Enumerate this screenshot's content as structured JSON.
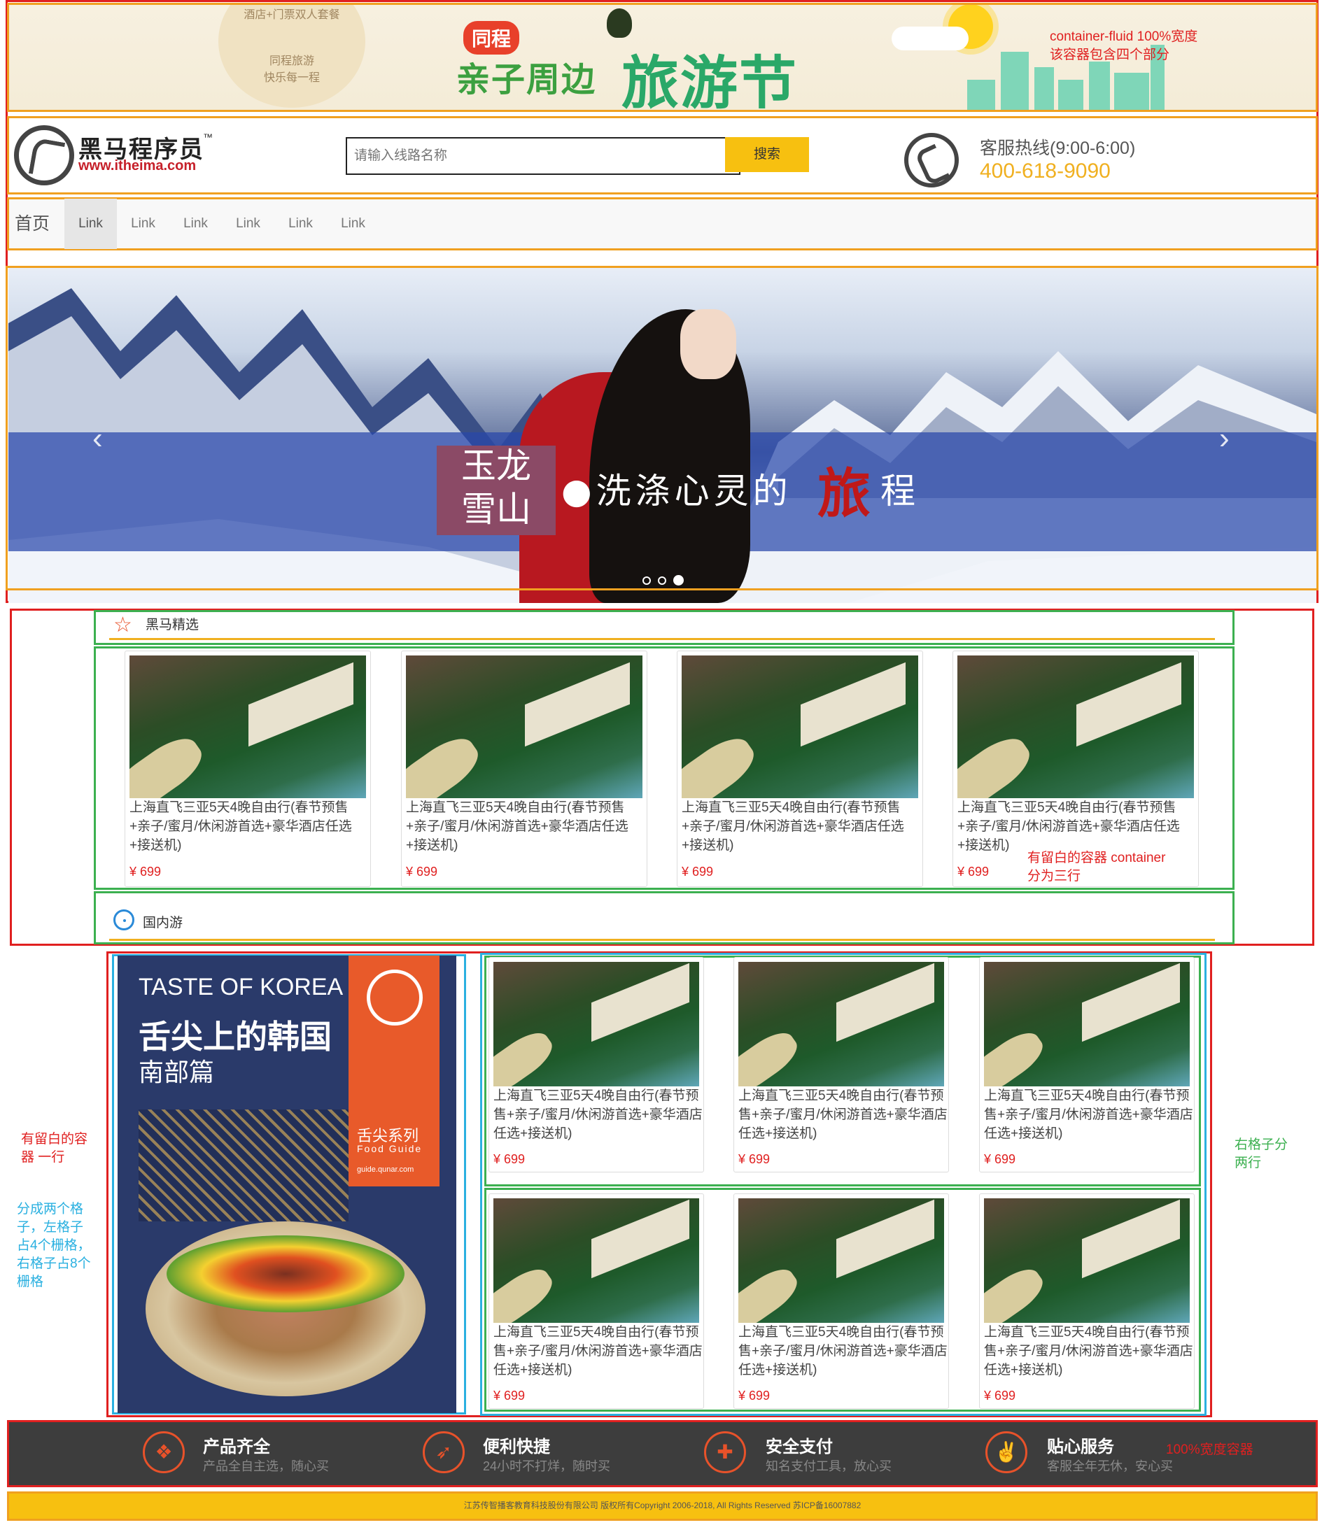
{
  "banner": {
    "package_label": "酒店+门票双人套餐",
    "brand_small": "同程旅游",
    "slogan": "快乐每一程",
    "tag": "同程",
    "title_left": "亲子周边",
    "title_right": "旅游节"
  },
  "annotations": {
    "fluid_line1": "container-fluid  100%宽度",
    "fluid_line2": "该容器包含四个部分",
    "container_line1": "有留白的容器 container",
    "container_line2": "分为三行",
    "row_note_line1": "有留白的容",
    "row_note_line2": "器 一行",
    "grid_note": [
      "分成两个格",
      "子，左格子",
      "占4个栅格，",
      "右格子占8个",
      "栅格"
    ],
    "right_rows_line1": "右格子分",
    "right_rows_line2": "两行",
    "footer_note": "100%宽度容器"
  },
  "header": {
    "logo_cn": "黑马程序员",
    "logo_tm": "™",
    "logo_url": "www.itheima.com",
    "search_placeholder": "请输入线路名称",
    "search_button": "搜索",
    "hotline_label": "客服热线(9:00-6:00)",
    "hotline_number": "400-618-9090"
  },
  "nav": {
    "home": "首页",
    "links": [
      "Link",
      "Link",
      "Link",
      "Link",
      "Link",
      "Link"
    ]
  },
  "carousel": {
    "seal_top": "玉龙",
    "seal_bottom": "雪山",
    "caption": "●洗涤心灵的",
    "caption_red": "旅",
    "caption_end": "程",
    "prev": "‹",
    "next": "›"
  },
  "sections": {
    "featured": "黑马精选",
    "domestic": "国内游"
  },
  "product": {
    "title": "上海直飞三亚5天4晚自由行(春节预售+亲子/蜜月/休闲游首选+豪华酒店任选+接送机)",
    "price": "¥ 699"
  },
  "poster": {
    "en": "TASTE OF KOREA",
    "cn": "舌尖上的韩国",
    "sub": "南部篇",
    "series": "舌尖系列",
    "guide": "Food Guide",
    "url": "guide.qunar.com"
  },
  "features": [
    {
      "title": "产品齐全",
      "sub": "产品全自主选，随心买",
      "icon": "grid-icon"
    },
    {
      "title": "便利快捷",
      "sub": "24小时不打烊，随时买",
      "icon": "rocket-icon"
    },
    {
      "title": "安全支付",
      "sub": "知名支付工具，放心买",
      "icon": "shield-icon"
    },
    {
      "title": "贴心服务",
      "sub": "客服全年无休，安心买",
      "icon": "thumbs-up-icon"
    }
  ],
  "copyright": "江苏传智播客教育科技股份有限公司 版权所有Copyright 2006-2018, All Rights Reserved 苏ICP备16007882"
}
